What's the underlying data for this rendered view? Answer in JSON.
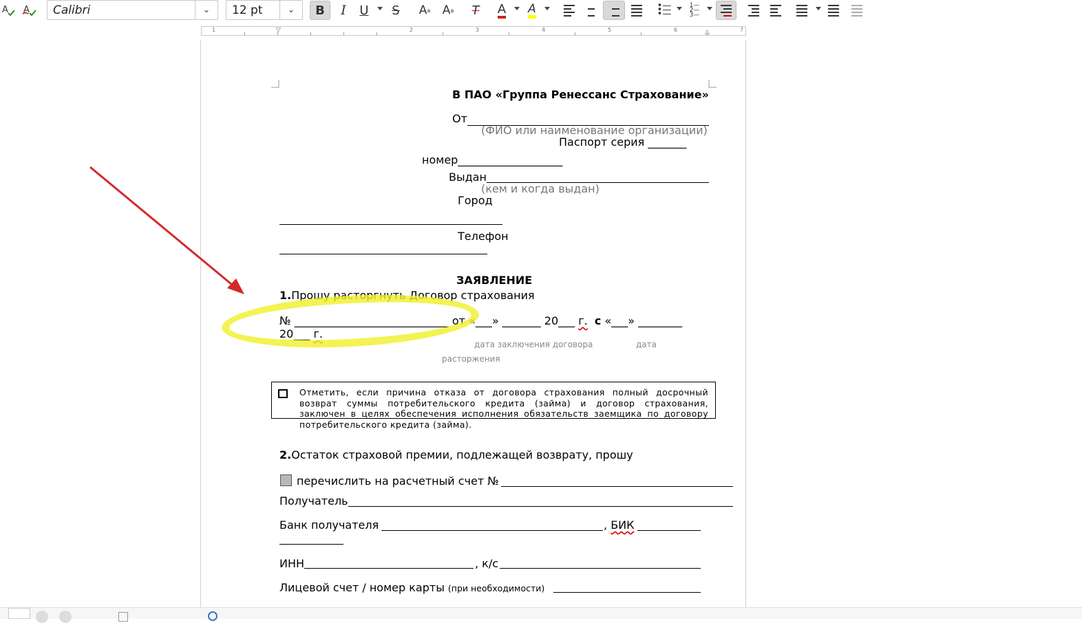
{
  "toolbar": {
    "font_name": "Calibri",
    "font_size": "12 pt",
    "bold_label": "B",
    "italic_label": "I",
    "underline_label": "U",
    "strike_label": "S",
    "superscript_label": "A",
    "subscript_label": "A",
    "clear_format_label": "T",
    "font_color_label": "A",
    "highlight_label": "A",
    "font_color": "#c9211e",
    "highlight_color": "#ffff00"
  },
  "document": {
    "to_company": "В ПАО «Группа Ренессанс Страхование»",
    "from_label": "От",
    "fio_hint": "(ФИО или наименование организации)",
    "passport_label": "Паспорт серия _______",
    "number_label": "номер___________________",
    "issued_label": "Выдан",
    "issued_hint": "(кем и когда выдан)",
    "city_label": "Город",
    "phone_label": "Телефон",
    "title": "ЗАЯВЛЕНИЕ",
    "p1_num": "1.",
    "p1_text": "Прошу расторгнуть Договор страхования",
    "contract_line_no": "№ ____________________________",
    "contract_line_from": "от «___» _______ 20___",
    "contract_line_g1": "г.",
    "contract_line_s": "с",
    "contract_line_s_tail": "«___» ________",
    "contract_line2_year": "20___",
    "contract_line2_g": "г.",
    "hint_date_concl": "дата заключения договора",
    "hint_date": "дата",
    "hint_termination": "расторжения",
    "note_text": "Отметить, если причина отказа от договора страхования полный досрочный возврат суммы потребительского кредита (займа) и договор страхования, заключен в целях обеспечения исполнения обязательств заемщика по договору потребительского кредита (займа).",
    "p2_num": "2.",
    "p2_text": "Остаток страховой премии, подлежащей возврату, прошу",
    "transfer_label": "перечислить на расчетный счет №",
    "recipient_label": "Получатель",
    "bank_label": "Банк получателя",
    "bik_prefix": ",",
    "bik_label": "БИК",
    "inn_label": "ИНН",
    "ks_label": ", к/с",
    "account_label": "Лицевой счет / номер карты",
    "account_hint": "(при необходимости)"
  },
  "annotation": {
    "arrow_color": "#d62828",
    "highlight_color": "#f0f028"
  }
}
